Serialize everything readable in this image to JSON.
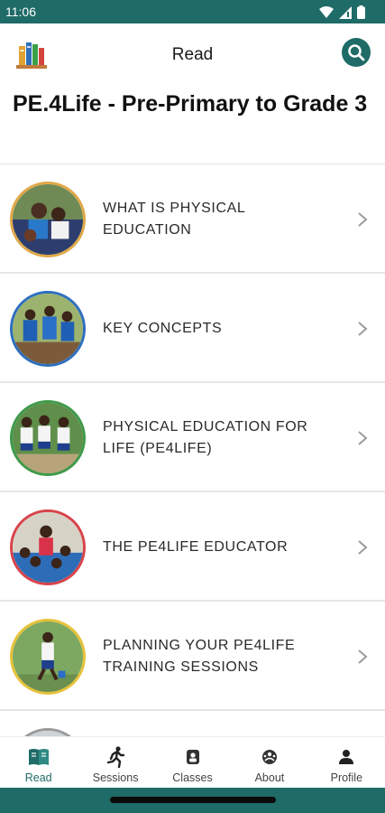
{
  "status_bar": {
    "time": "11:06",
    "icons": [
      "wifi-icon",
      "signal-icon",
      "battery-icon"
    ]
  },
  "header": {
    "title": "Read",
    "logo": "books-icon",
    "search_icon": "search-icon"
  },
  "page": {
    "title": "PE.4Life - Pre-Primary to Grade 3"
  },
  "colors": {
    "brand": "#1f6b67",
    "divider": "#e6e6e6",
    "background": "#ffffff"
  },
  "chapters": [
    {
      "label": "WHAT IS PHYSICAL EDUCATION",
      "ring_color": "#e0a94a"
    },
    {
      "label": "KEY CONCEPTS",
      "ring_color": "#2e6fbf"
    },
    {
      "label": "PHYSICAL EDUCATION FOR LIFE (PE4LIFE)",
      "ring_color": "#3f9a4a"
    },
    {
      "label": "THE PE4LIFE EDUCATOR",
      "ring_color": "#d8434a"
    },
    {
      "label": "PLANNING YOUR PE4LIFE TRAINING SESSIONS",
      "ring_color": "#e6c23a"
    },
    {
      "label": "",
      "ring_color": "#9a9a9a"
    }
  ],
  "bottom_nav": {
    "items": [
      {
        "label": "Read",
        "icon": "book-icon",
        "active": true
      },
      {
        "label": "Sessions",
        "icon": "running-icon",
        "active": false
      },
      {
        "label": "Classes",
        "icon": "class-icon",
        "active": false
      },
      {
        "label": "About",
        "icon": "about-icon",
        "active": false
      },
      {
        "label": "Profile",
        "icon": "person-icon",
        "active": false
      }
    ]
  }
}
